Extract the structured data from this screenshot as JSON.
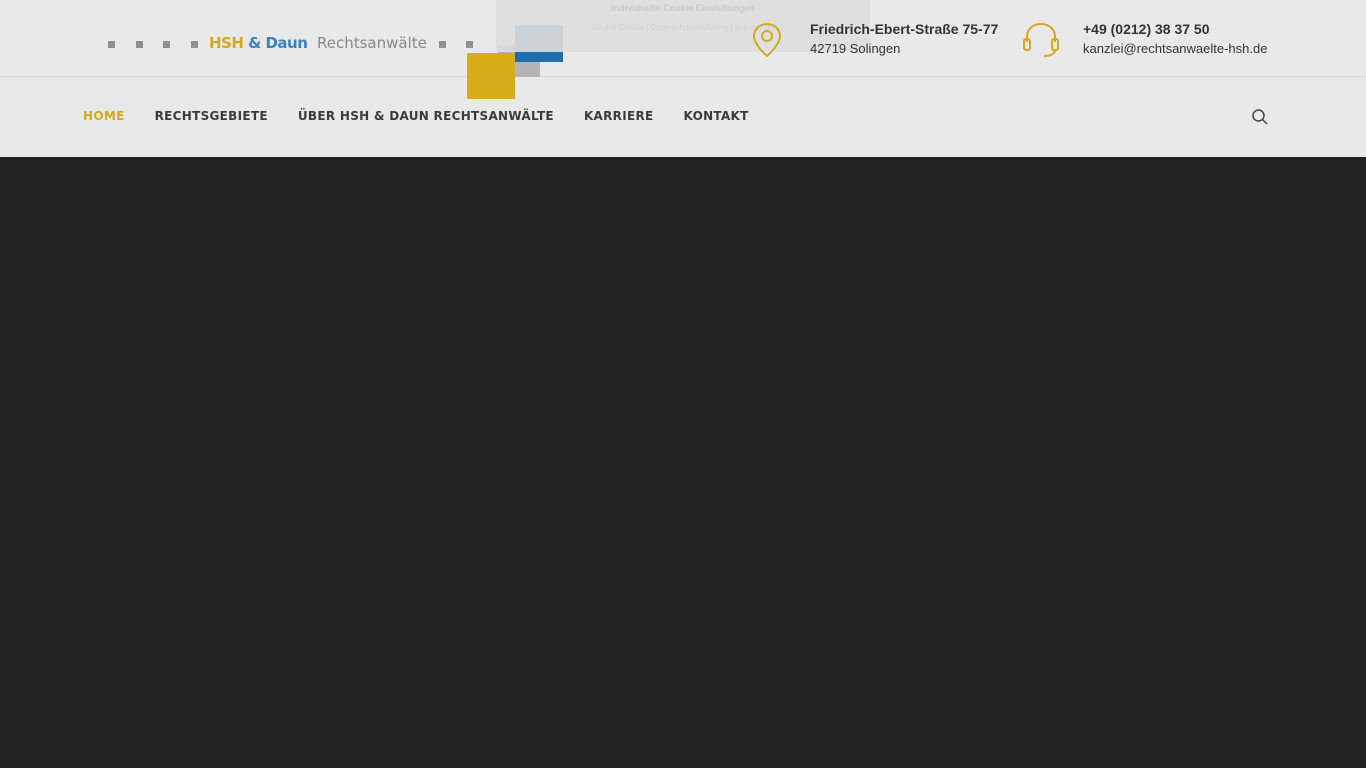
{
  "logo": {
    "brand_main": "HSH",
    "brand_amp": "& Daun",
    "brand_sub": "Rechtsanwälte"
  },
  "cookie_banner": {
    "title": "Individuelle Cookie Einstellungen",
    "links": [
      "Cookie-Details",
      "Datenschutzerklärung",
      "Impressum"
    ]
  },
  "contact": {
    "address": {
      "icon": "map-pin-icon",
      "street": "Friedrich-Ebert-Straße 75-77",
      "city": "42719 Solingen"
    },
    "phone": {
      "icon": "headset-icon",
      "number": "+49 (0212) 38 37 50",
      "email": "kanzlei@rechtsanwaelte-hsh.de"
    }
  },
  "nav": {
    "items": [
      {
        "label": "HOME",
        "active": true
      },
      {
        "label": "RECHTSGEBIETE",
        "active": false
      },
      {
        "label": "ÜBER HSH & DAUN RECHTSANWÄLTE",
        "active": false
      },
      {
        "label": "KARRIERE",
        "active": false
      },
      {
        "label": "KONTAKT",
        "active": false
      }
    ],
    "search_icon": "search-icon"
  },
  "colors": {
    "accent": "#d4aa1a",
    "blue": "#1f6eaf",
    "header_bg": "#e9e9e9",
    "page_bg": "#232323"
  }
}
